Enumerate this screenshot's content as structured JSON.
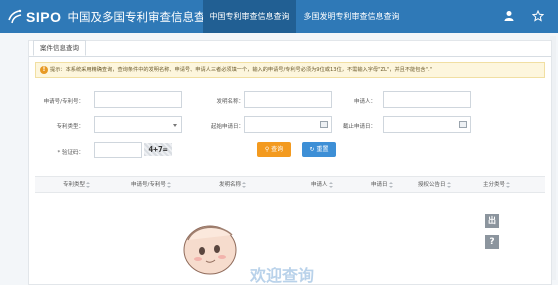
{
  "header": {
    "logo_text": "SIPO",
    "site_title": "中国及多国专利审查信息查询",
    "tabs": [
      {
        "label": "中国专利审查信息查询",
        "active": true
      },
      {
        "label": "多国发明专利审查信息查询",
        "active": false
      }
    ],
    "icons": [
      "user-icon",
      "star-icon"
    ],
    "colors": {
      "bar": "#2f79b7",
      "active_tab": "#215f93"
    }
  },
  "card": {
    "tab_label": "案件信息查询",
    "notice": "提示：本系统采用精确查询，查询条件中的发明名称、申请号、申请人三者必须填一个，输入的申请号/专利号必须为9位或13位，不需输入字母\"ZL\"，并且不能包含\".\"",
    "form": {
      "application_number_label": "申请号/专利号：",
      "invention_name_label": "发明名称：",
      "applicant_label": "申请人：",
      "patent_type_label": "专利类型：",
      "start_date_label": "起始申请日：",
      "end_date_label": "截止申请日：",
      "captcha_label": "* 验证码：",
      "captcha_text": "4+7=",
      "search_label": "查询",
      "reset_label": "重置"
    },
    "table": {
      "columns": [
        "专利类型",
        "申请号/专利号",
        "发明名称",
        "申请人",
        "申请日",
        "授权公告日",
        "主分类号"
      ]
    }
  },
  "side_buttons": [
    "出",
    "?"
  ],
  "watermark_text": "欢迎查询"
}
